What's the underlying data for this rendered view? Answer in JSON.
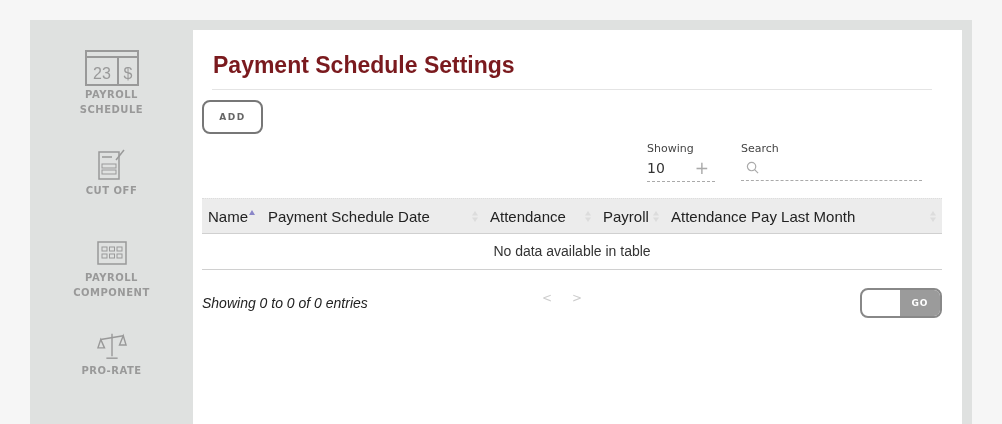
{
  "sidebar": {
    "items": [
      {
        "kind": "schedule",
        "label": "PAYROLL SCHEDULE",
        "icon_text": [
          "23",
          "$"
        ]
      },
      {
        "kind": "cutoff",
        "label": "CUT OFF"
      },
      {
        "kind": "component",
        "label": "PAYROLL COMPONENT"
      },
      {
        "kind": "prorate",
        "label": "PRO-RATE"
      }
    ]
  },
  "page_title": "Payment Schedule Settings",
  "add_button": "ADD",
  "page_length": {
    "label": "Showing",
    "value": "10",
    "stepper": "+"
  },
  "search": {
    "label": "Search"
  },
  "table": {
    "columns": [
      {
        "label": "Name",
        "sorted": true
      },
      {
        "label": "Payment Schedule Date",
        "sorted": false
      },
      {
        "label": "Attendance",
        "sorted": false
      },
      {
        "label": "Payroll",
        "sorted": false
      },
      {
        "label": "Attendance Pay Last Month",
        "sorted": false
      }
    ],
    "empty_message": "No data available in table"
  },
  "info": "Showing 0 to 0 of 0 entries",
  "pager": {
    "prev": "<",
    "next": ">"
  },
  "goto": {
    "button": "GO"
  }
}
